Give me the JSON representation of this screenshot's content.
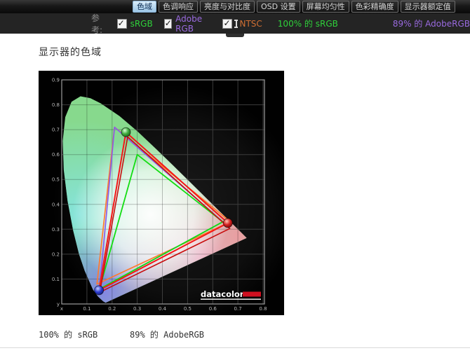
{
  "tab_bar": {
    "tabs": [
      {
        "label": "色域",
        "selected": true
      },
      {
        "label": "色调响应",
        "selected": false
      },
      {
        "label": "亮度与对比度",
        "selected": false
      },
      {
        "label": "OSD 设置",
        "selected": false
      },
      {
        "label": "屏幕均匀性",
        "selected": false
      },
      {
        "label": "色彩精确度",
        "selected": false
      },
      {
        "label": "显示器额定值",
        "selected": false
      }
    ]
  },
  "ref_bar": {
    "label": "参考:",
    "checkboxes": [
      {
        "label": "sRGB",
        "checked": true,
        "color": "#2fd13a"
      },
      {
        "label": "Adobe RGB",
        "checked": true,
        "color": "#9a6ae0"
      },
      {
        "label": "NTSC",
        "checked": true,
        "color": "#d06f33",
        "text_cursor": true
      }
    ],
    "stats": [
      {
        "text": "100% 的 sRGB",
        "color": "#2fd13a"
      },
      {
        "text": "89% 的 AdobeRGB",
        "color": "#9a6ae0"
      }
    ]
  },
  "main": {
    "heading": "显示器的色域",
    "footer_left": "100% 的 sRGB",
    "footer_right": "89% 的 AdobeRGB"
  },
  "chart_data": {
    "type": "line",
    "title": "显示器的色域 (CIE 1931 xy chromaticity diagram)",
    "xlabel": "x",
    "ylabel": "y",
    "xlim": [
      0,
      0.81
    ],
    "ylim": [
      0,
      0.9
    ],
    "grid": true,
    "x_ticks": [
      {
        "label": "x",
        "v": 0
      },
      {
        "label": "0.1",
        "v": 0.1
      },
      {
        "label": "0.2",
        "v": 0.2
      },
      {
        "label": "0.3",
        "v": 0.3
      },
      {
        "label": "0.4",
        "v": 0.4
      },
      {
        "label": "0.5",
        "v": 0.5
      },
      {
        "label": "0.6",
        "v": 0.6
      },
      {
        "label": "0.7",
        "v": 0.7
      },
      {
        "label": "0.8",
        "v": 0.8
      }
    ],
    "y_ticks": [
      {
        "label": "0.9",
        "v": 0.9
      },
      {
        "label": "0.8",
        "v": 0.8
      },
      {
        "label": "0.7",
        "v": 0.7
      },
      {
        "label": "0.6",
        "v": 0.6
      },
      {
        "label": "0.5",
        "v": 0.5
      },
      {
        "label": "0.4",
        "v": 0.4
      },
      {
        "label": "0.3",
        "v": 0.3
      },
      {
        "label": "0.2",
        "v": 0.2
      },
      {
        "label": "0.1",
        "v": 0.1
      },
      {
        "label": "y",
        "v": 0
      }
    ],
    "series": [
      {
        "name": "ntsc",
        "color": "#ff7a2e",
        "width": 1.7,
        "vertices": [
          [
            0.67,
            0.33
          ],
          [
            0.21,
            0.71
          ],
          [
            0.14,
            0.08
          ]
        ]
      },
      {
        "name": "adobe-rgb",
        "color": "#8a5ce8",
        "width": 1.7,
        "vertices": [
          [
            0.64,
            0.33
          ],
          [
            0.21,
            0.71
          ],
          [
            0.15,
            0.06
          ]
        ]
      },
      {
        "name": "srgb",
        "color": "#12dd12",
        "width": 1.8,
        "vertices": [
          [
            0.64,
            0.33
          ],
          [
            0.3,
            0.6
          ],
          [
            0.15,
            0.06
          ]
        ]
      },
      {
        "name": "display-shadow",
        "color": "#c80d0d",
        "width": 1.6,
        "vertices": [
          [
            0.262,
            0.671
          ],
          [
            0.668,
            0.303
          ],
          [
            0.151,
            0.047
          ]
        ]
      },
      {
        "name": "display",
        "color": "#f51616",
        "width": 2,
        "vertices": [
          [
            0.255,
            0.69
          ],
          [
            0.66,
            0.325
          ],
          [
            0.148,
            0.055
          ]
        ]
      }
    ],
    "markers": [
      {
        "primary": "green",
        "xy": [
          0.255,
          0.69
        ]
      },
      {
        "primary": "red",
        "xy": [
          0.66,
          0.325
        ]
      },
      {
        "primary": "blue",
        "xy": [
          0.148,
          0.055
        ]
      }
    ],
    "locus": [
      [
        0.1741,
        0.005
      ],
      [
        0.1644,
        0.0109
      ],
      [
        0.144,
        0.0297
      ],
      [
        0.1241,
        0.0578
      ],
      [
        0.0913,
        0.1327
      ],
      [
        0.0687,
        0.2007
      ],
      [
        0.0454,
        0.295
      ],
      [
        0.0235,
        0.4127
      ],
      [
        0.0082,
        0.5384
      ],
      [
        0.0039,
        0.6548
      ],
      [
        0.0139,
        0.7502
      ],
      [
        0.0389,
        0.812
      ],
      [
        0.0743,
        0.8338
      ],
      [
        0.1142,
        0.8262
      ],
      [
        0.1547,
        0.8059
      ],
      [
        0.2296,
        0.7543
      ],
      [
        0.3016,
        0.6923
      ],
      [
        0.3731,
        0.6245
      ],
      [
        0.4441,
        0.5547
      ],
      [
        0.5125,
        0.4866
      ],
      [
        0.5752,
        0.4242
      ],
      [
        0.627,
        0.3725
      ],
      [
        0.6658,
        0.334
      ],
      [
        0.6915,
        0.3083
      ],
      [
        0.714,
        0.2859
      ],
      [
        0.7347,
        0.2653
      ]
    ],
    "coverage": {
      "srgb": "100%",
      "adobe_rgb": "89%"
    },
    "logo": "datacolor"
  }
}
